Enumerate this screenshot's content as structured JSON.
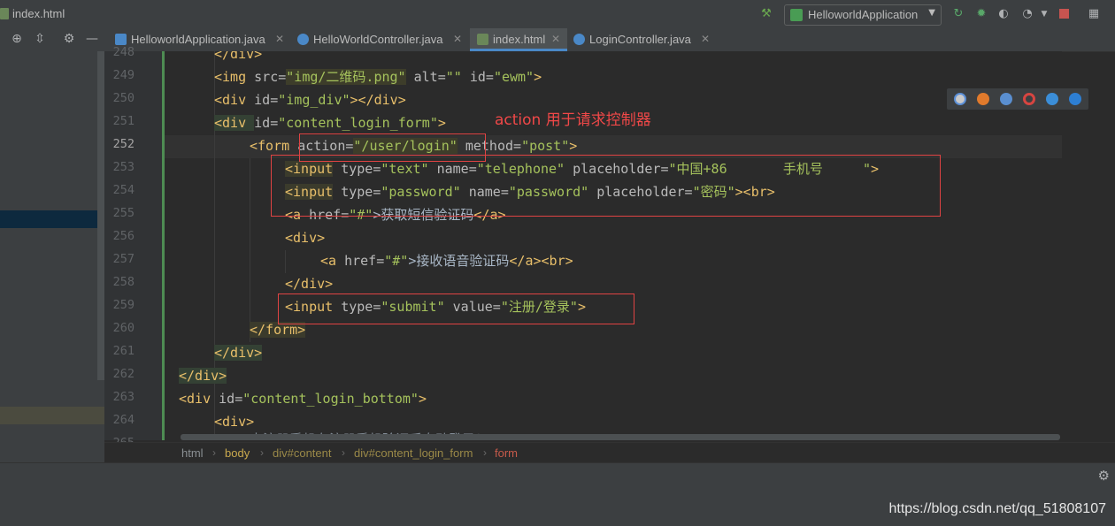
{
  "window": {
    "title": "index.html"
  },
  "toolbar": {
    "run_config": "HelloworldApplication",
    "build_icon": "hammer-icon",
    "rerun_icon": "rerun-icon",
    "debug_icon": "bug-icon",
    "coverage_icon": "shield-icon",
    "profile_icon": "profile-icon",
    "stop_icon": "stop-icon",
    "layout_icon": "layout-icon"
  },
  "tabs": [
    {
      "label": "HelloworldApplication.java",
      "kind": "app"
    },
    {
      "label": "HelloWorldController.java",
      "kind": "class"
    },
    {
      "label": "index.html",
      "kind": "html",
      "active": true
    },
    {
      "label": "LoginController.java",
      "kind": "class"
    }
  ],
  "gutter": {
    "lines": [
      "248",
      "249",
      "250",
      "251",
      "252",
      "253",
      "254",
      "255",
      "256",
      "257",
      "258",
      "259",
      "260",
      "261",
      "262",
      "263",
      "264",
      "265"
    ],
    "current": "252"
  },
  "code": {
    "l248": "</div>",
    "l249": {
      "open": "<img ",
      "a1": "src=",
      "v1": "\"img/二维码.png\"",
      "a2": " alt=",
      "v2": "\"\"",
      "a3": " id=",
      "v3": "\"ewm\"",
      "close": ">"
    },
    "l250": {
      "open": "<div ",
      "a1": "id=",
      "v1": "\"img_div\"",
      "close": "></div>"
    },
    "l251": {
      "open": "<div ",
      "a1": "id=",
      "v1": "\"content_login_form\"",
      "close": ">"
    },
    "l252": {
      "open": "<form ",
      "a1": "action=",
      "v1": "\"/user/login\"",
      "a2": " method=",
      "v2": "\"post\"",
      "close": ">"
    },
    "l253": {
      "open": "<input",
      "a1": " type=",
      "v1": "\"text\"",
      "a2": " name=",
      "v2": "\"telephone\"",
      "a3": " placeholder=",
      "v3": "\"中国+86       手机号     \"",
      "close": ">"
    },
    "l254": {
      "open": "<input",
      "a1": " type=",
      "v1": "\"password\"",
      "a2": " name=",
      "v2": "\"password\"",
      "a3": " placeholder=",
      "v3": "\"密码\"",
      "close": "><br>"
    },
    "l255": {
      "open": "<a ",
      "a1": "href=",
      "v1": "\"#\"",
      "t1": ">获取短信验证码",
      "close": "</a>"
    },
    "l256": "<div>",
    "l257": {
      "open": "<a ",
      "a1": "href=",
      "v1": "\"#\"",
      "t1": ">接收语音验证码",
      "close": "</a><br>"
    },
    "l258": "</div>",
    "l259": {
      "open": "<input",
      "a1": " type=",
      "v1": "\"submit\"",
      "a2": " value=",
      "v2": "\"注册/登录\"",
      "close": ">"
    },
    "l260": "</form>",
    "l261": "</div>",
    "l262": "</div>",
    "l263": {
      "open": "<div ",
      "a1": "id=",
      "v1": "\"content_login_bottom\"",
      "close": ">"
    },
    "l264": "<div>",
    "l265": "未注册手机在注册手机验证后自动登录！"
  },
  "annotation": "action 用于请求控制器",
  "browsers": [
    "chrome-icon",
    "firefox-icon",
    "safari-icon",
    "opera-icon",
    "ie-icon",
    "edge-icon"
  ],
  "breadcrumb": [
    "html",
    "body",
    "div#content",
    "div#content_login_form",
    "form"
  ],
  "watermark": "https://blog.csdn.net/qq_51808107",
  "colors": {
    "tag": "#e8bf6a",
    "value": "#a5c25c",
    "attr": "#bababa",
    "annotation_red": "#f04848",
    "accent": "#4a88c7"
  }
}
